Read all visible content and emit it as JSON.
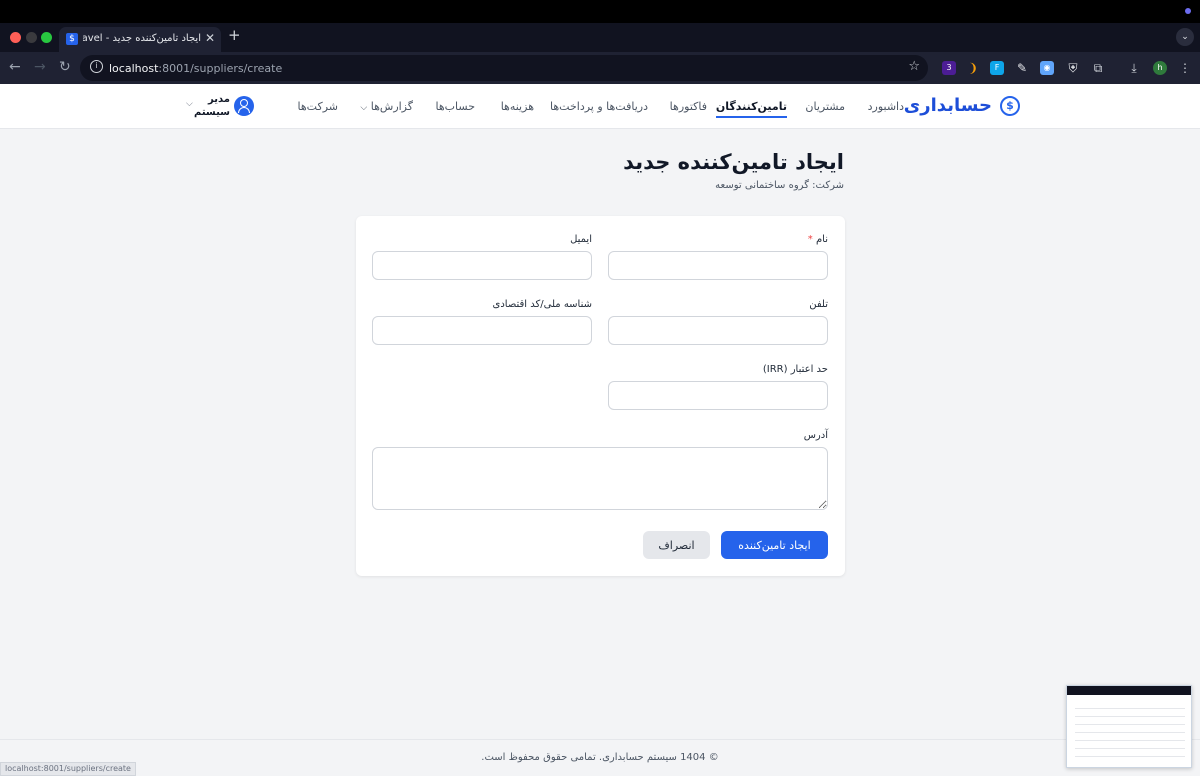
{
  "browser": {
    "tab_title": "ایجاد تامین‌کننده جدید - Laravel",
    "tab_favicon": "$",
    "url_host": "localhost",
    "url_path": ":8001/suppliers/create",
    "extension_badge": "3",
    "profile_initial": "h",
    "status_url": "localhost:8001/suppliers/create"
  },
  "header": {
    "brand": "حسابداری",
    "nav": [
      {
        "label": "داشبورد"
      },
      {
        "label": "مشتریان"
      },
      {
        "label": "تامین‌کنندگان"
      },
      {
        "label": "فاکتورها"
      },
      {
        "label": "دریافت‌ها و پرداخت‌ها"
      },
      {
        "label": "هزینه‌ها"
      },
      {
        "label": "حساب‌ها"
      },
      {
        "label": "گزارش‌ها"
      },
      {
        "label": "شرکت‌ها"
      }
    ],
    "user_name": "مدیر سیستم"
  },
  "page": {
    "title": "ایجاد تامین‌کننده جدید",
    "subtitle": "شرکت: گروه ساختمانی توسعه"
  },
  "form": {
    "name_label": "نام",
    "required_mark": "*",
    "email_label": "ایمیل",
    "phone_label": "تلفن",
    "national_id_label": "شناسه ملی/کد اقتصادی",
    "credit_limit_label": "حد اعتبار (IRR)",
    "address_label": "آدرس",
    "name_value": "",
    "email_value": "",
    "phone_value": "",
    "national_id_value": "",
    "credit_limit_value": "",
    "address_value": "",
    "submit_label": "ایجاد تامین‌کننده",
    "cancel_label": "انصراف"
  },
  "footer": {
    "text": "© 1404 سیستم حسابداری. تمامی حقوق محفوظ است."
  },
  "colors": {
    "primary": "#2563eb",
    "required": "#ef4444"
  }
}
